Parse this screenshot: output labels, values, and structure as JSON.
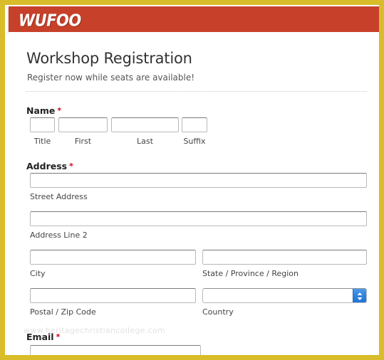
{
  "frame": {
    "border_color": "#d9bc29",
    "background": "#ffffff"
  },
  "header": {
    "brand": "WUFOO",
    "background_color": "#c7402a",
    "text_color": "#ffffff"
  },
  "form": {
    "title": "Workshop Registration",
    "subtitle": "Register now while seats are available!",
    "required_marker": "*",
    "required_color": "#d0021b",
    "watermark": "www.heritagechristiancollege.com",
    "sections": [
      {
        "id": "name",
        "label": "Name",
        "required": true,
        "fields": [
          {
            "id": "title",
            "sub_label": "Title",
            "value": "",
            "placeholder": ""
          },
          {
            "id": "first",
            "sub_label": "First",
            "value": "",
            "placeholder": ""
          },
          {
            "id": "last",
            "sub_label": "Last",
            "value": "",
            "placeholder": ""
          },
          {
            "id": "suffix",
            "sub_label": "Suffix",
            "value": "",
            "placeholder": ""
          }
        ]
      },
      {
        "id": "address",
        "label": "Address",
        "required": true,
        "fields": [
          {
            "id": "street",
            "sub_label": "Street Address",
            "value": "",
            "placeholder": ""
          },
          {
            "id": "line2",
            "sub_label": "Address Line 2",
            "value": "",
            "placeholder": ""
          },
          {
            "id": "city",
            "sub_label": "City",
            "value": "",
            "placeholder": ""
          },
          {
            "id": "state",
            "sub_label": "State / Province / Region",
            "value": "",
            "placeholder": ""
          },
          {
            "id": "postal",
            "sub_label": "Postal / Zip Code",
            "value": "",
            "placeholder": ""
          },
          {
            "id": "country",
            "sub_label": "Country",
            "value": "",
            "type": "select",
            "selected": ""
          }
        ]
      },
      {
        "id": "email",
        "label": "Email",
        "required": true,
        "fields": [
          {
            "id": "email",
            "sub_label": "",
            "value": "",
            "placeholder": ""
          }
        ]
      }
    ]
  }
}
